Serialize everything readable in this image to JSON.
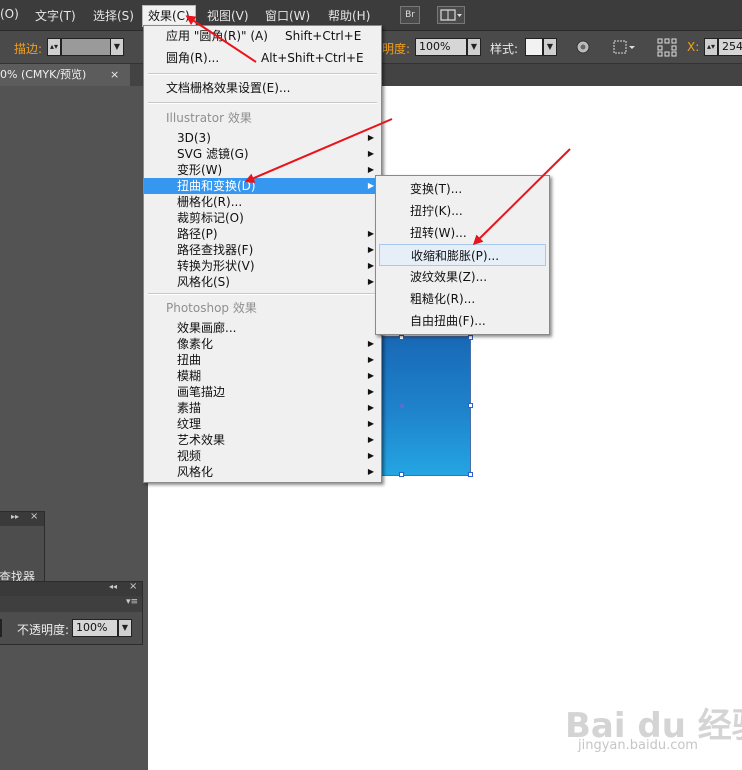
{
  "menubar": {
    "items": [
      "(O)",
      "文字(T)",
      "选择(S)",
      "效果(C)",
      "视图(V)",
      "窗口(W)",
      "帮助(H)"
    ],
    "bridge_label": "Br"
  },
  "controlbar": {
    "stroke_label": "描边:",
    "opacity_label": "明度:",
    "opacity_value": "100%",
    "style_label": "样式:",
    "x_label": "X:",
    "x_value": "254"
  },
  "tab": {
    "title": "0% (CMYK/预览)",
    "close": "×"
  },
  "effect_menu": {
    "top_items": [
      {
        "label": "应用 \"圆角(R)\" (A)",
        "shortcut": "Shift+Ctrl+E"
      },
      {
        "label": "圆角(R)...",
        "shortcut": "Alt+Shift+Ctrl+E"
      }
    ],
    "doc_raster": "文档栅格效果设置(E)...",
    "illustrator_header": "Illustrator 效果",
    "illustrator_items": [
      "3D(3)",
      "SVG 滤镜(G)",
      "变形(W)",
      "扭曲和变换(D)",
      "栅格化(R)...",
      "裁剪标记(O)",
      "路径(P)",
      "路径查找器(F)",
      "转换为形状(V)",
      "风格化(S)"
    ],
    "photoshop_header": "Photoshop 效果",
    "photoshop_items": [
      "效果画廊...",
      "像素化",
      "扭曲",
      "模糊",
      "画笔描边",
      "素描",
      "纹理",
      "艺术效果",
      "视频",
      "风格化"
    ]
  },
  "submenu": {
    "items": [
      "变换(T)...",
      "扭拧(K)...",
      "扭转(W)...",
      "收缩和膨胀(P)...",
      "波纹效果(Z)...",
      "粗糙化(R)...",
      "自由扭曲(F)..."
    ]
  },
  "panels": {
    "pathfinder_partial": "查找器",
    "transparency_opacity_label": "不透明度:",
    "transparency_opacity_value": "100%"
  },
  "watermark": {
    "logo": "Bai du 经验",
    "url": "jingyan.baidu.com"
  },
  "colors": {
    "menu_highlight": "#3597f0",
    "annotation_arrow": "#e8141b",
    "shape_fill": "#1f84cc"
  },
  "icons": [
    "bridge-icon",
    "workspace-icon",
    "recolor-icon",
    "grid-icon",
    "arrow-right-icon",
    "close-icon"
  ]
}
